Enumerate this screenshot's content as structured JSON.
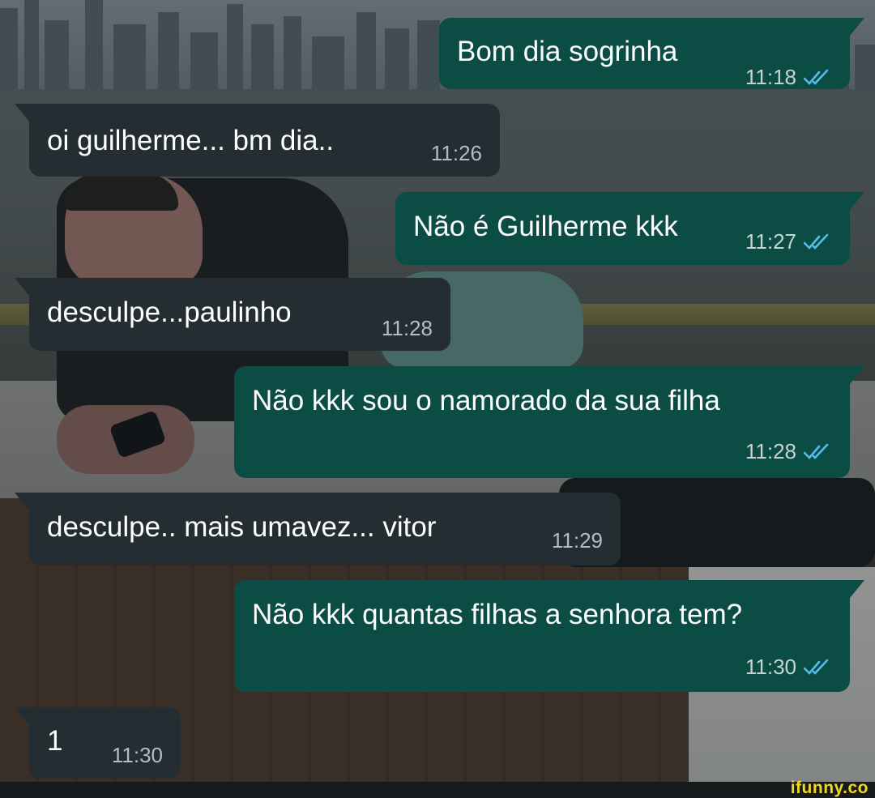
{
  "conversation": {
    "messages": [
      {
        "direction": "out",
        "text": "Bom dia sogrinha",
        "time": "11:18",
        "status": "read"
      },
      {
        "direction": "in",
        "text": "oi guilherme... bm dia..",
        "time": "11:26"
      },
      {
        "direction": "out",
        "text": "Não é Guilherme kkk",
        "time": "11:27",
        "status": "read"
      },
      {
        "direction": "in",
        "text": "desculpe...paulinho",
        "time": "11:28"
      },
      {
        "direction": "out",
        "text": "Não kkk sou o namorado da sua filha",
        "time": "11:28",
        "status": "read"
      },
      {
        "direction": "in",
        "text": "desculpe.. mais umavez... vitor",
        "time": "11:29"
      },
      {
        "direction": "out",
        "text": "Não kkk quantas filhas a senhora tem?",
        "time": "11:30",
        "status": "read"
      },
      {
        "direction": "in",
        "text": "1",
        "time": "11:30"
      }
    ]
  },
  "colors": {
    "outgoing_bubble": "#0b4d45",
    "incoming_bubble": "#232d32",
    "read_ticks": "#53bdeb",
    "watermark": "#f2d81f"
  },
  "icons": {
    "read_receipt": "double-check-icon"
  },
  "watermark": {
    "text": "ifunny.co"
  }
}
